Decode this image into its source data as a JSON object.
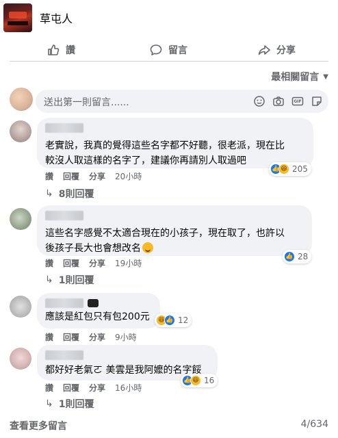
{
  "page": {
    "name": "草屯人"
  },
  "actions": {
    "like": "讚",
    "comment": "留言",
    "share": "分享"
  },
  "sort": {
    "label": "最相關留言"
  },
  "compose": {
    "placeholder": "送出第一則留言......",
    "icons": [
      "emoji-icon",
      "camera-icon",
      "gif-icon",
      "sticker-icon"
    ],
    "gif_label": "GIF"
  },
  "comments": [
    {
      "text_line1": "老實說，我真的覺得這些名字都不好聽，很老派，現在比",
      "text_line2": "較沒人取這樣的名字了，建議你再請別人取過吧",
      "like": "讚",
      "reply": "回覆",
      "share": "分享",
      "time": "20小時",
      "reaction_count": "205",
      "replies": "8則回覆"
    },
    {
      "text_line1": "這些名字感覺不太適合現在的小孩子，現在取了，也許以",
      "text_line2": "後孩子長大也會想改名",
      "like": "讚",
      "reply": "回覆",
      "share": "分享",
      "time": "19小時",
      "reaction_count": "28",
      "replies": "1則回覆"
    },
    {
      "text_line1": "應該是紅包只有包200元",
      "like": "讚",
      "reply": "回覆",
      "share": "分享",
      "time": "9小時",
      "reaction_count": "12"
    },
    {
      "text_line1": "都好好老氣ㄛ 美雲是我阿嬤的名字餒",
      "like": "讚",
      "reply": "回覆",
      "share": "分享",
      "time": "16小時",
      "reaction_count": "16",
      "replies": "1則回覆"
    }
  ],
  "footer": {
    "view_more": "查看更多留言",
    "pager": "4/634"
  },
  "colors": {
    "accent": "#1877f2",
    "muted": "#65676b",
    "bubble": "#f0f2f5"
  }
}
